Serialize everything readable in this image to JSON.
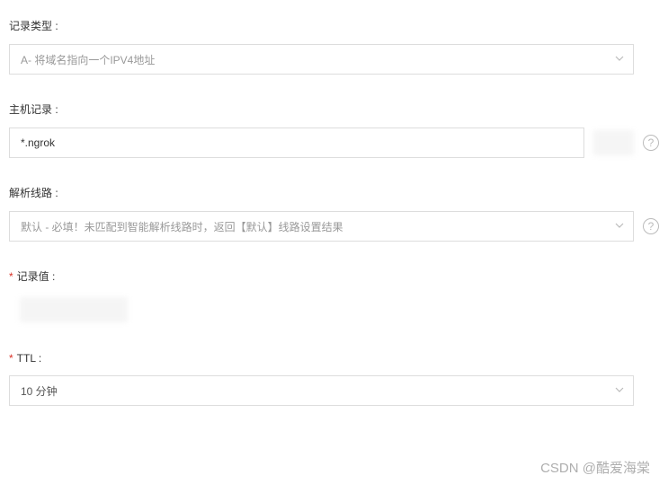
{
  "fields": {
    "record_type": {
      "label": "记录类型 :",
      "value": "A- 将域名指向一个IPV4地址"
    },
    "host_record": {
      "label": "主机记录 :",
      "value": "*.ngrok"
    },
    "resolution_line": {
      "label": "解析线路 :",
      "value": "默认 - 必填！未匹配到智能解析线路时，返回【默认】线路设置结果"
    },
    "record_value": {
      "label": "记录值 :",
      "value": ""
    },
    "ttl": {
      "label": "TTL :",
      "value": "10 分钟"
    }
  },
  "required_marker": "*",
  "help_glyph": "?",
  "watermark": "CSDN @酷爱海棠"
}
